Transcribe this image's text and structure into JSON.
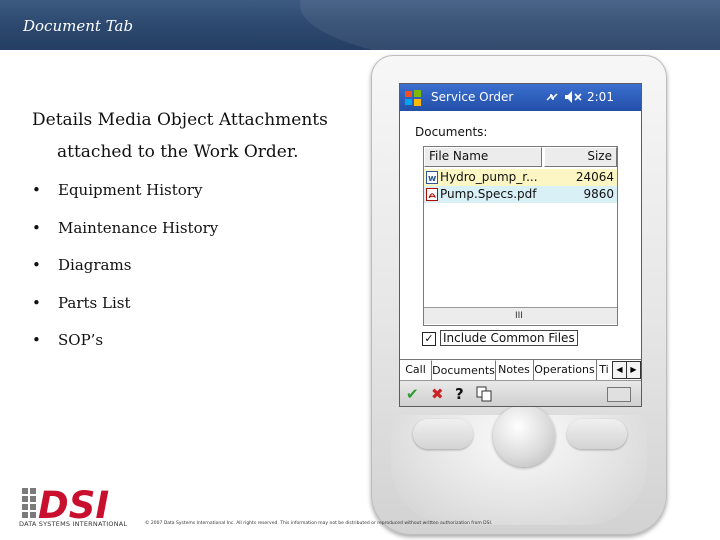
{
  "slide": {
    "header_title": "Document Tab",
    "intro_line1": "Details Media Object Attachments",
    "intro_line2": "attached to the Work Order.",
    "bullets": [
      "Equipment History",
      "Maintenance History",
      "Diagrams",
      "Parts List",
      "SOP’s"
    ],
    "bullet_char": "•"
  },
  "device": {
    "app_title": "Service Order",
    "time": "2:01",
    "documents_label": "Documents:",
    "columns": {
      "name": "File Name",
      "size": "Size"
    },
    "rows": [
      {
        "icon": "word-doc-icon",
        "name": "Hydro_pump_r...",
        "size": "24064",
        "highlight": "#fbf6c3"
      },
      {
        "icon": "pdf-doc-icon",
        "name": "Pump.Specs.pdf",
        "size": "9860",
        "highlight": "#d9f0f7"
      }
    ],
    "scroll_thumb": "III",
    "include_common_files": {
      "label": "Include Common Files",
      "checked": true
    },
    "tabs": [
      "Call",
      "Documents",
      "Notes",
      "Operations",
      "Ti"
    ],
    "active_tab": "Documents",
    "toolbar": {
      "ok_glyph": "✔",
      "cancel_glyph": "✖",
      "help_glyph": "?",
      "icons": [
        "ok-icon",
        "cancel-icon",
        "help-icon",
        "copy-icon",
        "keyboard-icon"
      ]
    },
    "colors": {
      "titlebar": "#234fa8",
      "ok": "#2f9a2f",
      "cancel": "#cc2222"
    }
  },
  "footer": {
    "brand": "DSI",
    "brand_sub": "DATA SYSTEMS INTERNATIONAL",
    "copyright": "© 2007 Data Systems International Inc. All rights reserved. This information may not be distributed or reproduced without written authorization from DSI."
  }
}
